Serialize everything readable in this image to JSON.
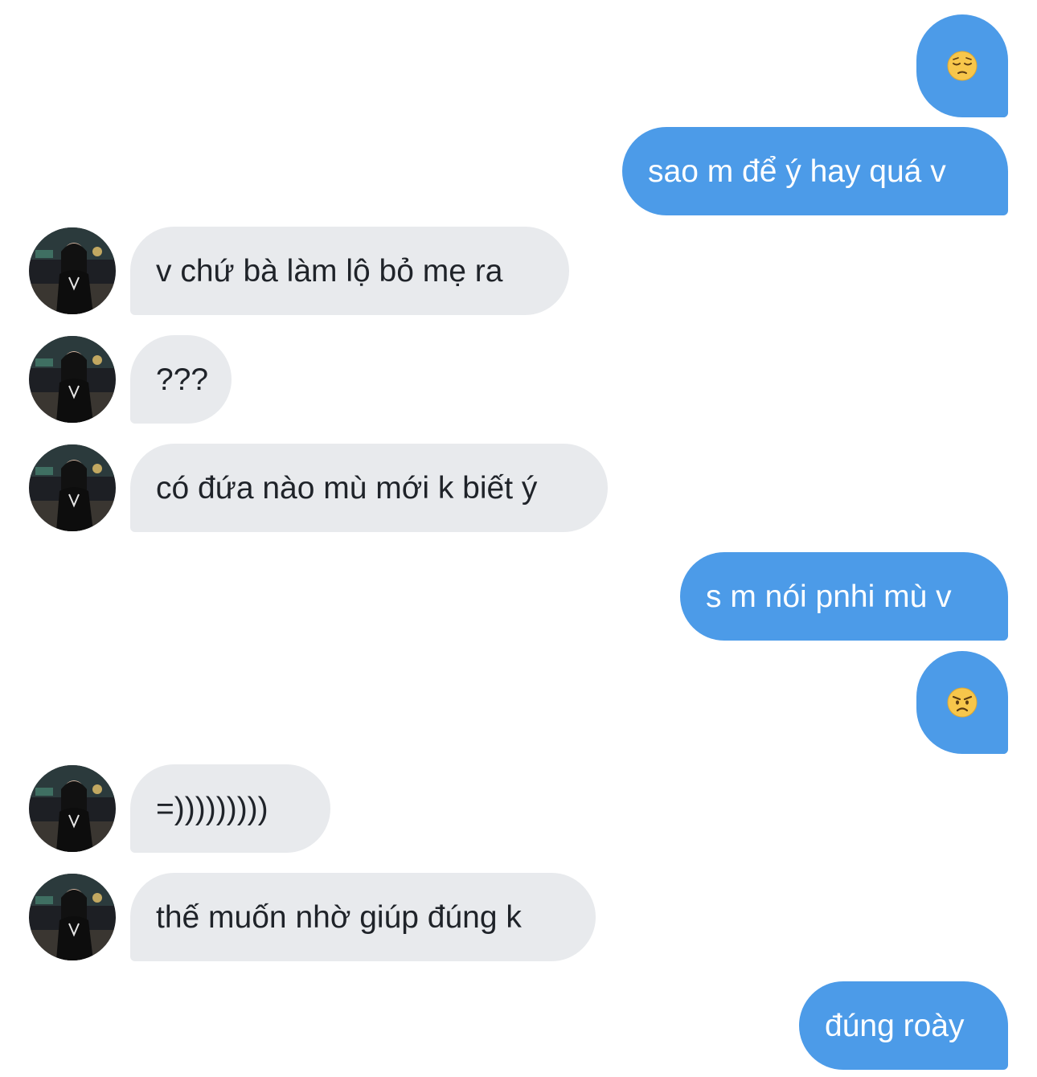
{
  "conversation": {
    "messages": [
      {
        "side": "sent",
        "type": "emoji",
        "icon": "pensive-face-icon"
      },
      {
        "side": "sent",
        "text": "sao m để ý hay quá v"
      },
      {
        "side": "received",
        "text": "v chứ bà làm lộ bỏ mẹ ra"
      },
      {
        "side": "received",
        "text": "???"
      },
      {
        "side": "received",
        "text": "có đứa nào mù mới k biết ý"
      },
      {
        "side": "sent",
        "text": "s m nói pnhi mù v"
      },
      {
        "side": "sent",
        "type": "emoji",
        "icon": "angry-face-icon"
      },
      {
        "side": "received",
        "text": "=)))))))))"
      },
      {
        "side": "received",
        "text": "thế muốn nhờ giúp đúng k"
      },
      {
        "side": "sent",
        "text": "đúng roày"
      }
    ]
  },
  "colors": {
    "sent_bubble": "#4c9be8",
    "received_bubble": "#e8eaed",
    "sent_text": "#ffffff",
    "received_text": "#1f2329"
  }
}
